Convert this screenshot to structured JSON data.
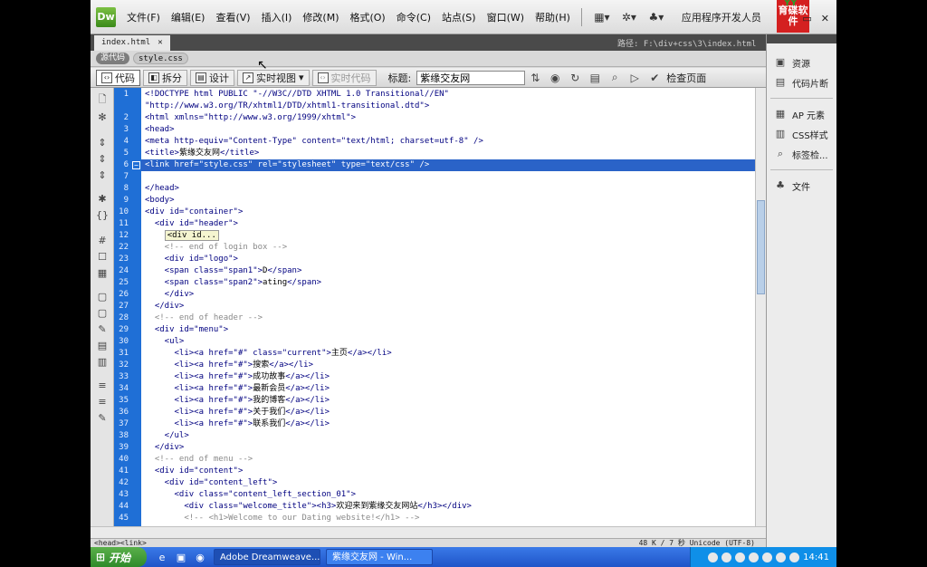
{
  "window": {
    "app_logo": "Dw",
    "menus": [
      "文件(F)",
      "编辑(E)",
      "查看(V)",
      "插入(I)",
      "修改(M)",
      "格式(O)",
      "命令(C)",
      "站点(S)",
      "窗口(W)",
      "帮助(H)"
    ],
    "workspace": "应用程序开发人员",
    "brand_logo": "育碟软件"
  },
  "document": {
    "tab_name": "index.html",
    "path": "路径: F:\\div+css\\3\\index.html",
    "related_files": {
      "source": "源代码",
      "css": "style.css"
    }
  },
  "view_toolbar": {
    "code": "代码",
    "split": "拆分",
    "design": "设计",
    "live_view": "实时视图",
    "live_code": "实时代码",
    "title_label": "标题:",
    "title_value": "紫缘交友网",
    "check_page": "检查页面"
  },
  "code": {
    "line_numbers": [
      "1",
      "",
      "2",
      "3",
      "4",
      "5",
      "6",
      "7",
      "8",
      "9",
      "10",
      "11",
      "12",
      "22",
      "23",
      "24",
      "25",
      "26",
      "27",
      "28",
      "29",
      "30",
      "31",
      "32",
      "33",
      "34",
      "35",
      "36",
      "37",
      "38",
      "39",
      "40",
      "41",
      "42",
      "43",
      "44",
      "45"
    ],
    "selected_line": "6"
  },
  "status": {
    "tags": "<head><link>",
    "right": "48 K / 7 秒  Unicode (UTF-8)"
  },
  "right_panel": {
    "items": [
      "资源",
      "代码片断",
      "AP 元素",
      "CSS样式",
      "标签检...",
      "文件"
    ]
  },
  "taskbar": {
    "start": "开始",
    "tasks": [
      "Adobe Dreamweave...",
      "紫缘交友网 - Win..."
    ],
    "clock": "14:41"
  }
}
